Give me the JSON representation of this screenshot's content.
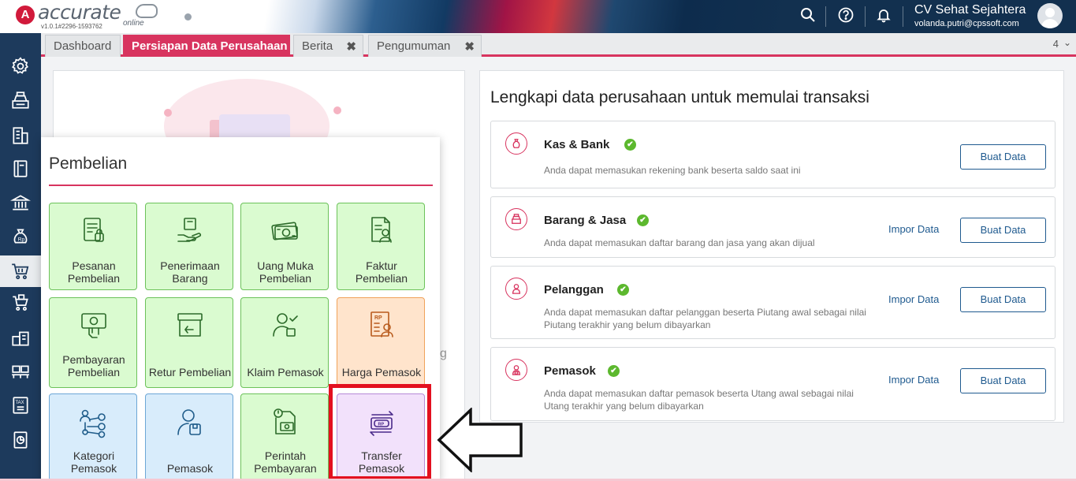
{
  "header": {
    "logo_text": "accurate",
    "logo_sub": "online",
    "version": "v1.0.1#2296-1593762",
    "company_name": "CV Sehat Sejahtera",
    "user_email": "volanda.putri@cpssoft.com",
    "icons": [
      "search-icon",
      "help-icon",
      "bell-icon"
    ]
  },
  "sidebar": {
    "items": [
      "settings-icon",
      "cash-register-icon",
      "building-icon",
      "book-icon",
      "bank-icon",
      "money-bag-icon",
      "cart-icon",
      "sales-cart-icon",
      "warehouse-icon",
      "pallet-icon",
      "tax-icon",
      "report-icon"
    ],
    "active": "cart-icon"
  },
  "tabs": [
    {
      "label": "Dashboard",
      "active": false,
      "closable": false
    },
    {
      "label": "Persiapan Data Perusahaan",
      "active": true,
      "closable": false
    },
    {
      "label": "Berita",
      "active": false,
      "closable": true
    },
    {
      "label": "Pengumuman",
      "active": false,
      "closable": true
    }
  ],
  "tab_count": "4",
  "main": {
    "title": "Lengkapi data perusahaan untuk memulai transaksi",
    "tasks": [
      {
        "name": "Kas & Bank",
        "desc": "Anda dapat memasukan rekening bank beserta saldo saat ini",
        "impor": "",
        "buat": "Buat Data",
        "icon": "money-bag-icon"
      },
      {
        "name": "Barang & Jasa",
        "desc": "Anda dapat memasukan daftar barang dan jasa yang akan dijual",
        "impor": "Impor Data",
        "buat": "Buat Data",
        "icon": "cash-register-icon"
      },
      {
        "name": "Pelanggan",
        "desc": "Anda dapat memasukan daftar pelanggan beserta Piutang awal sebagai nilai Piutang terakhir yang belum dibayarkan",
        "impor": "Impor Data",
        "buat": "Buat Data",
        "icon": "customer-icon"
      },
      {
        "name": "Pemasok",
        "desc": "Anda dapat memasukan daftar pemasok beserta Utang awal sebagai nilai Utang terakhir yang belum dibayarkan",
        "impor": "Impor Data",
        "buat": "Buat Data",
        "icon": "supplier-icon"
      }
    ],
    "left_card_fragment": "g"
  },
  "popup": {
    "title": "Pembelian",
    "items": [
      {
        "label": "Pesanan Pembelian",
        "color": "green",
        "icon": "purchase-order-icon"
      },
      {
        "label": "Penerimaan Barang",
        "color": "green",
        "icon": "receive-goods-icon"
      },
      {
        "label": "Uang Muka Pembelian",
        "color": "green",
        "icon": "down-payment-icon"
      },
      {
        "label": "Faktur Pembelian",
        "color": "green",
        "icon": "invoice-icon"
      },
      {
        "label": "Pembayaran Pembelian",
        "color": "green",
        "icon": "payment-icon"
      },
      {
        "label": "Retur Pembelian",
        "color": "green",
        "icon": "return-icon"
      },
      {
        "label": "Klaim Pemasok",
        "color": "green",
        "icon": "claim-icon"
      },
      {
        "label": "Harga Pemasok",
        "color": "orange",
        "icon": "supplier-price-icon"
      },
      {
        "label": "Kategori Pemasok",
        "color": "blue",
        "icon": "category-icon"
      },
      {
        "label": "Pemasok",
        "color": "blue",
        "icon": "supplier-icon"
      },
      {
        "label": "Perintah Pembayaran",
        "color": "green",
        "icon": "payment-order-icon"
      },
      {
        "label": "Transfer Pemasok",
        "color": "purple",
        "icon": "transfer-icon"
      }
    ]
  },
  "colors": {
    "accent": "#d8345f",
    "sidebar": "#1d3a5c",
    "highlight": "#e3101f",
    "link": "#1f5a8f",
    "check": "#5cb82e"
  }
}
